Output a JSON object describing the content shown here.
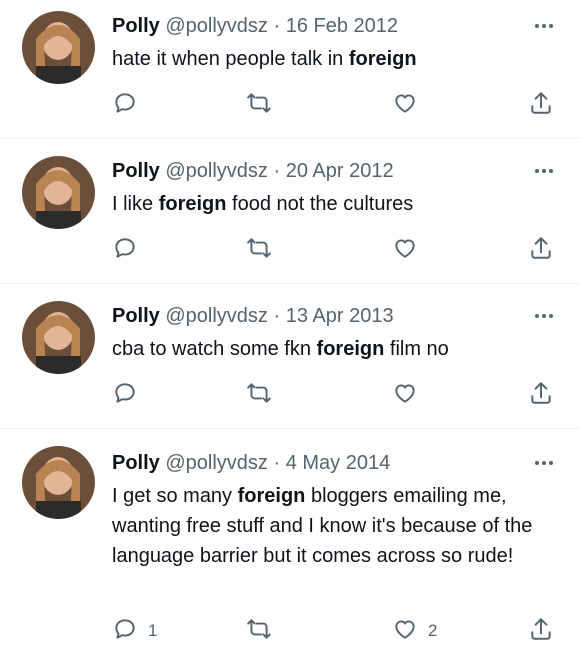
{
  "tweets": [
    {
      "name": "Polly",
      "handle": "@pollyvdsz",
      "separator": "·",
      "date": "16 Feb 2012",
      "text_parts": [
        "hate it when people talk in ",
        "foreign",
        ""
      ],
      "replies": "",
      "likes": ""
    },
    {
      "name": "Polly",
      "handle": "@pollyvdsz",
      "separator": "·",
      "date": "20 Apr 2012",
      "text_parts": [
        "I like ",
        "foreign",
        " food not the cultures"
      ],
      "replies": "",
      "likes": ""
    },
    {
      "name": "Polly",
      "handle": "@pollyvdsz",
      "separator": "·",
      "date": "13 Apr 2013",
      "text_parts": [
        "cba to watch some fkn ",
        "foreign",
        " film no"
      ],
      "replies": "",
      "likes": ""
    },
    {
      "name": "Polly",
      "handle": "@pollyvdsz",
      "separator": "·",
      "date": "4 May 2014",
      "text_parts": [
        "I get so many ",
        "foreign",
        " bloggers emailing me, wanting free stuff and I know it's because of the language barrier but it comes across so rude!"
      ],
      "replies": "1",
      "likes": "2"
    }
  ],
  "icons": {
    "reply": "reply-icon",
    "retweet": "retweet-icon",
    "like": "like-icon",
    "share": "share-icon",
    "more": "more-icon",
    "avatar": "avatar"
  },
  "colors": {
    "text": "#0f1419",
    "secondary": "#536471",
    "divider": "#eff3f4"
  }
}
